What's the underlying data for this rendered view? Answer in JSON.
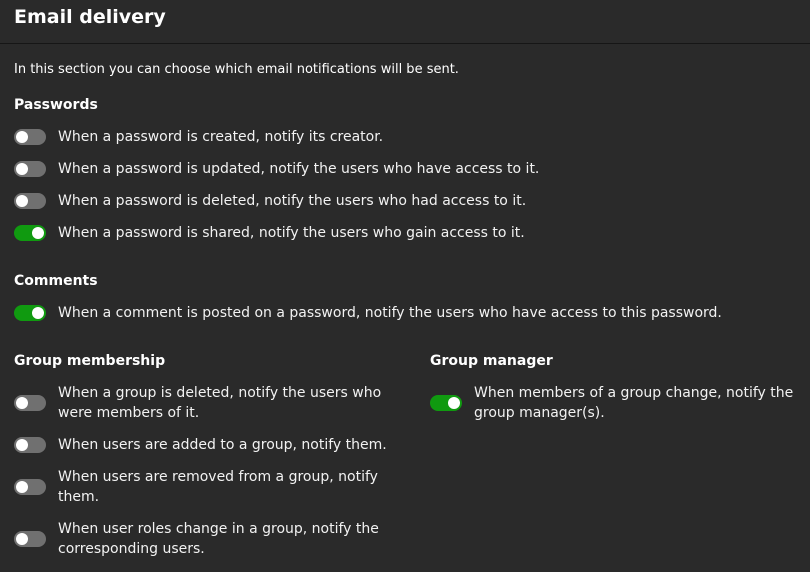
{
  "header": {
    "title": "Email delivery"
  },
  "intro": "In this section you can choose which email notifications will be sent.",
  "passwords": {
    "title": "Passwords",
    "items": [
      {
        "label": "When a password is created, notify its creator.",
        "enabled": false
      },
      {
        "label": "When a password is updated, notify the users who have access to it.",
        "enabled": false
      },
      {
        "label": "When a password is deleted, notify the users who had access to it.",
        "enabled": false
      },
      {
        "label": "When a password is shared, notify the users who gain access to it.",
        "enabled": true
      }
    ]
  },
  "comments": {
    "title": "Comments",
    "items": [
      {
        "label": "When a comment is posted on a password, notify the users who have access to this password.",
        "enabled": true
      }
    ]
  },
  "group_membership": {
    "title": "Group membership",
    "items": [
      {
        "label": "When a group is deleted, notify the users who were members of it.",
        "enabled": false
      },
      {
        "label": "When users are added to a group, notify them.",
        "enabled": false
      },
      {
        "label": "When users are removed from a group, notify them.",
        "enabled": false
      },
      {
        "label": "When user roles change in a group, notify the corresponding users.",
        "enabled": false
      }
    ]
  },
  "group_manager": {
    "title": "Group manager",
    "items": [
      {
        "label": "When members of a group change, notify the group manager(s).",
        "enabled": true
      }
    ]
  },
  "colors": {
    "background": "#2a2a2a",
    "toggle_on": "#109a10",
    "toggle_off": "#707070"
  }
}
